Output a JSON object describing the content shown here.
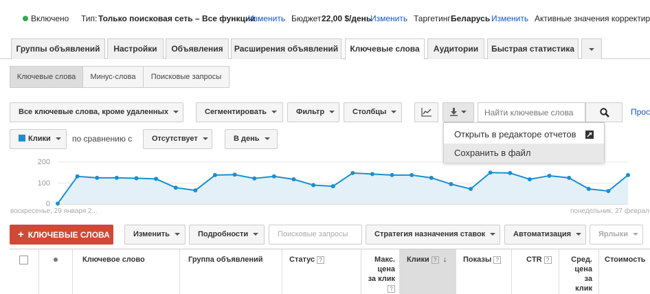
{
  "status": {
    "enabled": "Включено",
    "type_label": "Тип:",
    "type_value": "Только поисковая сеть – Все функции",
    "type_change": "Изменить",
    "budget_label": "Бюджет:",
    "budget_value": "22,00 $/день",
    "budget_change": "Изменить",
    "targeting_label": "Таргетинг:",
    "targeting_value": "Беларусь",
    "targeting_change": "Изменить",
    "active_values": "Активные значения корректиров"
  },
  "tabs": [
    "Группы объявлений",
    "Настройки",
    "Объявления",
    "Расширения объявлений",
    "Ключевые слова",
    "Аудитории",
    "Быстрая статистика"
  ],
  "subtabs": [
    "Ключевые слова",
    "Минус-слова",
    "Поисковые запросы"
  ],
  "toolbar": {
    "filter_all": "Все ключевые слова, кроме удаленных",
    "segment": "Сегментировать",
    "filter": "Фильтр",
    "columns": "Столбцы",
    "search_placeholder": "Найти ключевые слова",
    "prosmotr": "Прос"
  },
  "download_menu": {
    "open_in_report": "Открыть в редакторе отчетов",
    "save_to_file": "Сохранить в файл"
  },
  "chart_controls": {
    "metric": "Клики",
    "compare": "по сравнению с",
    "compare_value": "Отсутствует",
    "period": "В день"
  },
  "chart_data": {
    "type": "area",
    "series": [
      {
        "name": "Клики",
        "values": [
          2,
          132,
          125,
          125,
          123,
          120,
          78,
          65,
          138,
          140,
          122,
          132,
          118,
          90,
          85,
          148,
          143,
          138,
          138,
          125,
          95,
          72,
          150,
          148,
          118,
          135,
          125,
          72,
          62,
          138
        ]
      }
    ],
    "y_ticks": [
      "200",
      "100",
      "0"
    ],
    "ylim": [
      0,
      200
    ],
    "x_start_label": "воскресенье, 29 января 2...",
    "x_end_label": "понедельник, 27 феврал",
    "color": "#1a8fd0",
    "fill": "#e3f0f8"
  },
  "bottom_toolbar": {
    "add_keywords": "КЛЮЧЕВЫЕ СЛОВА",
    "edit": "Изменить",
    "details": "Подробности",
    "search_queries": "Поисковые запросы",
    "bid_strategy": "Стратегия назначения ставок",
    "automation": "Автоматизация",
    "labels": "Ярлыки"
  },
  "table_header": {
    "keyword": "Ключевое слово",
    "ad_group": "Группа объявлений",
    "status": "Статус",
    "max_cpc": "Макс. цена за клик",
    "clicks": "Клики",
    "impressions": "Показы",
    "ctr": "CTR",
    "avg_cpc": "Сред. цена за клик",
    "cost": "Стоимость"
  },
  "colors": {
    "accent": "#1155cc",
    "add_button": "#d14836",
    "status_dot": "#34a853"
  }
}
